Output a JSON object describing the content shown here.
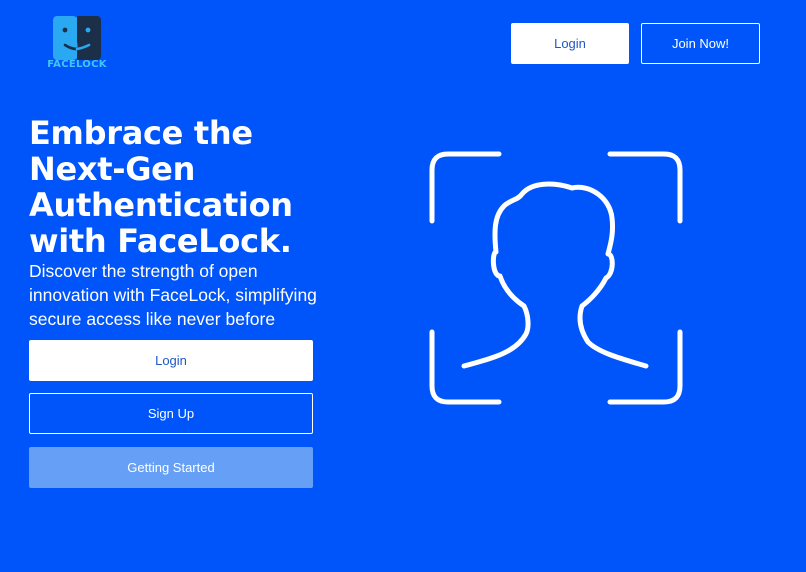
{
  "brand": {
    "name": "FACELOCK",
    "logo_icon": "face-split-icon",
    "colors": {
      "logo_left": "#2aa8f2",
      "logo_right": "#1c2f48",
      "text": "#3fc6f7"
    }
  },
  "header": {
    "login_label": "Login",
    "join_label": "Join Now!"
  },
  "hero": {
    "title_lines": [
      "Embrace the",
      "Next-Gen",
      "Authentication",
      "with FaceLock."
    ],
    "subtitle_lines": [
      "Discover the strength of open",
      "innovation with FaceLock, simplifying",
      "secure access like never before"
    ]
  },
  "actions": {
    "login_label": "Login",
    "signup_label": "Sign Up",
    "getting_started_label": "Getting Started"
  },
  "illustration": {
    "icon": "face-scan-icon"
  },
  "colors": {
    "background": "#0055fa",
    "button_text_primary": "#1f57c7",
    "getting_started_bg": "#66a0f6"
  }
}
